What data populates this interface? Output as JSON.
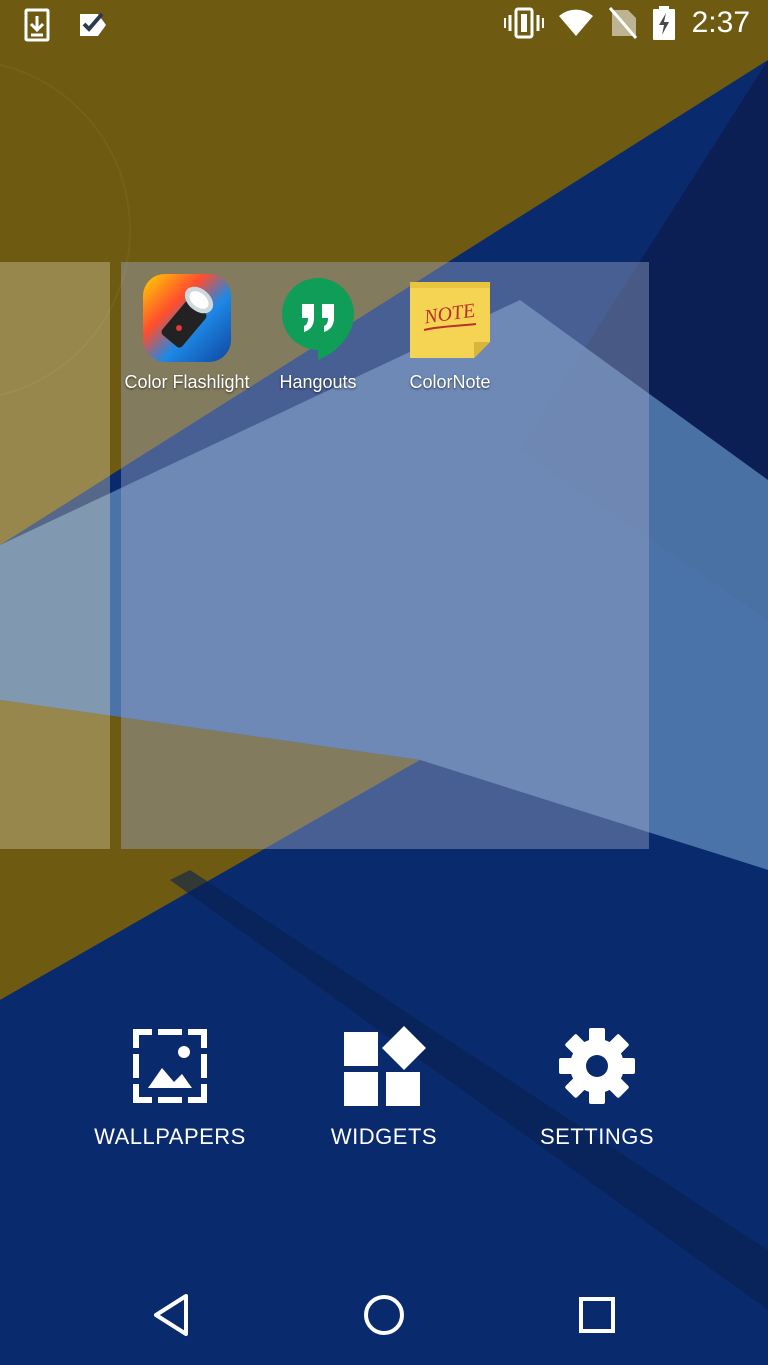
{
  "status_bar": {
    "time": "2:37",
    "left_icons": [
      "download-icon",
      "checkmark-app-icon"
    ],
    "right_icons": [
      "vibrate-icon",
      "wifi-icon",
      "no-sim-icon",
      "battery-charging-icon"
    ]
  },
  "apps": [
    {
      "label": "Color Flashlight",
      "icon": "color-flashlight-icon"
    },
    {
      "label": "Hangouts",
      "icon": "hangouts-icon"
    },
    {
      "label": "ColorNote",
      "icon": "colornote-icon"
    }
  ],
  "overview": {
    "wallpapers_label": "WALLPAPERS",
    "widgets_label": "WIDGETS",
    "settings_label": "SETTINGS"
  },
  "nav_bar": {
    "buttons": [
      "back-icon",
      "home-icon",
      "recents-icon"
    ]
  },
  "colors": {
    "wallpaper_gold": "#6e5a10",
    "wallpaper_navy": "#0a2a6e",
    "wallpaper_light_blue": "#5a86b8",
    "hangouts_green": "#0f9d58",
    "colornote_yellow": "#f5d453"
  }
}
